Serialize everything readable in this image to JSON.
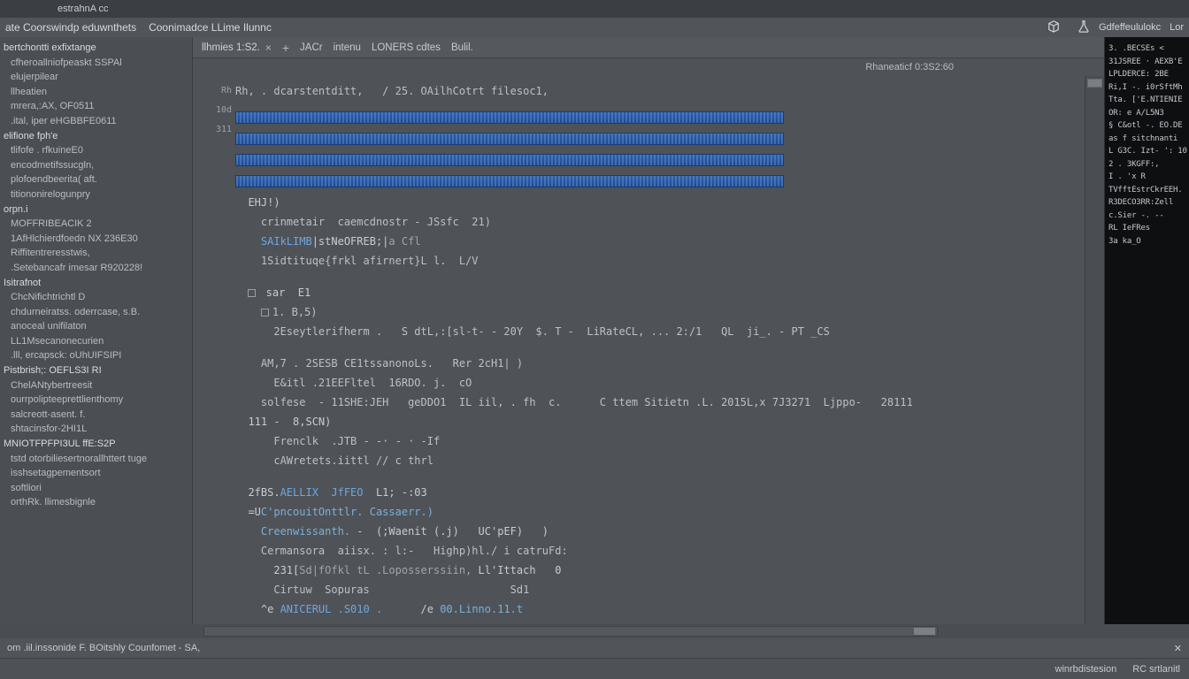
{
  "titlebar": {
    "text": "estrahnA  cc"
  },
  "menubar": {
    "items": [
      "ate Coorswindp eduwnthets",
      "Coonimadce LLime  Ilunnc"
    ],
    "right_icons": [
      "cube-icon",
      "flask-icon"
    ],
    "right_labels": [
      "",
      "Gdfeffeululokc",
      "Lor"
    ]
  },
  "sidebar": {
    "items": [
      {
        "label": "bertchontti  exfixtange",
        "cls": "group"
      },
      {
        "label": "cfheroallniofpeaskt SSPAl",
        "cls": "sub"
      },
      {
        "label": "elujerpilear",
        "cls": "sub"
      },
      {
        "label": "llheatien",
        "cls": "sub"
      },
      {
        "label": "mrera,:AX, OF0511",
        "cls": "sub"
      },
      {
        "label": ".ital, iper eHGBBFE0611",
        "cls": "sub"
      },
      {
        "label": "elifione fph'e",
        "cls": "group"
      },
      {
        "label": "tlifofe   . rfkuineE0",
        "cls": "sub"
      },
      {
        "label": "encodmetifssucgln,",
        "cls": "sub"
      },
      {
        "label": "plofoendbeerita( aft.",
        "cls": "sub"
      },
      {
        "label": "titiononirelogunpry",
        "cls": "sub"
      },
      {
        "label": "orpn.i",
        "cls": "group"
      },
      {
        "label": "MOFFRIBEACIK   2",
        "cls": "sub"
      },
      {
        "label": "1AfHlchierdfoedn NX  236E30",
        "cls": "sub"
      },
      {
        "label": "Riffitentreresstwis,",
        "cls": "sub"
      },
      {
        "label": ".Setebancafr imesar R920228!",
        "cls": "sub"
      },
      {
        "label": "Isitrafnot",
        "cls": "group"
      },
      {
        "label": "ChcNifichtrichtl D",
        "cls": "sub"
      },
      {
        "label": "chdurneiratss. oderrcase,   s.B.",
        "cls": "sub"
      },
      {
        "label": "anoceal unifilaton",
        "cls": "sub"
      },
      {
        "label": "LL1Msecanonecurien",
        "cls": "sub"
      },
      {
        "label": ".lll, ercapsck: oUhUIFSIPI",
        "cls": "sub"
      },
      {
        "label": "Pistbrish;: OEFLS3I    RI",
        "cls": "group"
      },
      {
        "label": "ChelANtybertreesit",
        "cls": "sub"
      },
      {
        "label": "ourrpolipteeprettlienthomy",
        "cls": "sub"
      },
      {
        "label": "salcreott-asent.  f.",
        "cls": "sub"
      },
      {
        "label": "shtacinsfor-2HI1L",
        "cls": "sub"
      },
      {
        "label": "MNIOTFPFPI3UL   ffE:S2P",
        "cls": "group"
      },
      {
        "label": "tstd otorbiliesertnorallhttert tuge",
        "cls": "sub"
      },
      {
        "label": "isshsetagpementsort",
        "cls": "sub"
      },
      {
        "label": "softliori",
        "cls": "sub"
      },
      {
        "label": "orthRk.   llimesbignle",
        "cls": "sub"
      }
    ]
  },
  "tabs": {
    "active": "llhmies 1:S2.",
    "close": "×",
    "plus": "+",
    "labels": [
      "JACr",
      "intenu",
      "LONERS  cdtes",
      "Bulil."
    ]
  },
  "subheader": {
    "right": "Rhaneaticf 0:3S2:60"
  },
  "gutter": [
    "Rh",
    "",
    "",
    "10d",
    "311",
    ""
  ],
  "code": {
    "head": "Rh, . dcarstentditt,   / 25. OAilhCotrt filesoc1,",
    "lines": [
      {
        "t": "EHJ!)",
        "indent": 1
      },
      {
        "t": "crinmetair  caemcdnostr - JSsfc  21)",
        "indent": 2,
        "dim": true
      },
      {
        "t": "<kw>SAIkLIMB</kw>|stNeOFREB;|<pale>a Cfl</pale>",
        "indent": 2
      },
      {
        "t": "1Sidtituqe{frkl afirnert}L l.  L/V",
        "indent": 2,
        "dim": true
      }
    ],
    "block2": [
      {
        "t": "<box></box> sar  E1",
        "indent": 1
      },
      {
        "t": "<box></box>1. B,5)",
        "indent": 2,
        "dim": true
      },
      {
        "t": "2Eseytlerifherm .   S dtL,:[sl-t- - 20Y  $. T -  LiRateCL, ... 2:/1   QL  ji_. - PT _CS",
        "indent": 3,
        "dim": true
      }
    ],
    "block3": [
      {
        "t": "AM,7 . 2SESB CE1tssanonoLs.   Rer 2cH1| )",
        "indent": 2,
        "dim": true
      },
      {
        "t": "E&itl .21EEFltel  16RDO. j.  cO",
        "indent": 3,
        "dim": true
      },
      {
        "t": "solfese  - 11SHE:JEH   geDDO1  IL iil, . fh  c.      C ttem Sitietn .L. 2015L,x 7J3271  Ljppo-   28111",
        "indent": 2,
        "dim": true
      },
      {
        "t": "111 -  8,SCN)",
        "indent": 1
      },
      {
        "t": "Frenclk  .JTB - -· - · -If",
        "indent": 3,
        "dim": true
      },
      {
        "t": "cAWretets.iittl // c thrl",
        "indent": 3,
        "dim": true
      }
    ],
    "block4": [
      {
        "t": "2fBS.<kw>AELLIX  JfFEO</kw>  L1; -:03",
        "indent": 1
      },
      {
        "t": "=U<fn>C'pncouitOnttlr. Cassaerr.)</fn>",
        "indent": 1
      },
      {
        "t": "<fn>Creenwissanth.</fn> -  (;Waenit (.j)   UC'pEF)   )",
        "indent": 2
      },
      {
        "t": "Cermansora  aiisx. : l:-   Highp)hl./ i catruFd:",
        "indent": 2,
        "dim": true
      },
      {
        "t": "231[<pale>Sd|fOfkl tL .Loposserssiin,</pale> Ll'Ittach   0",
        "indent": 3
      },
      {
        "t": "Cirtuw  Sopuras                      Sd1",
        "indent": 3,
        "dim": true
      },
      {
        "t": "^e <kw>ANICERUL .S010 .</kw>      /e <fn>00.Linno.11.t</fn>",
        "indent": 2
      }
    ]
  },
  "rightpanel_lines": [
    "3.  .BECSEs  <",
    "31JSREE · AEXB'E",
    "LPLDERCE: 2BE",
    "Ri,I -.  i0rSftMh",
    "Tta. ['E.NTIENIE",
    "OR: e A/L5N3",
    "§ C&otl -.  EO.DE",
    "as  f sitchnanti",
    "L G3C. Izt- ':  10",
    "2 . 3KGFF:,",
    "I .  'x R",
    "TVfftEstrCkrEEH.",
    "R3DECO3RR:Zell",
    "c.Sier -. --",
    "RL IeFRes",
    "   3a  ka_O"
  ],
  "secondary_bar": {
    "left": "om     .iil.inssonide   F. BOitshly  Counfomet - SA,",
    "right_close": "✕"
  },
  "statusbar": {
    "left": "",
    "right1": "winrbdistesion",
    "right2": "RC  srtlanitl"
  }
}
